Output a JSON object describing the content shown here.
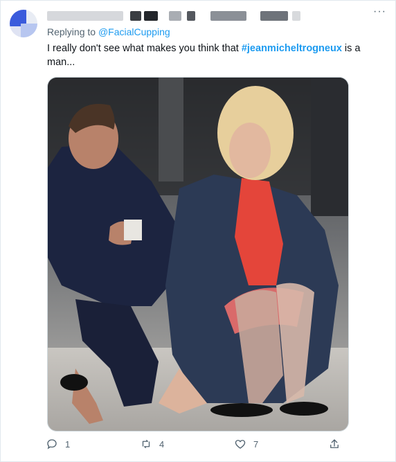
{
  "tweet": {
    "replying_prefix": "Replying to",
    "replying_handle": "@FacialCupping",
    "text_before": "I really don't see what makes you think that ",
    "hashtag": "#jeanmicheltrogneux",
    "text_after": " is a man...",
    "more_label": "···",
    "media_icon": "photo"
  },
  "actions": {
    "reply_count": "1",
    "retweet_count": "4",
    "like_count": "7",
    "reply_icon": "reply-icon",
    "retweet_icon": "retweet-icon",
    "like_icon": "heart-icon",
    "share_icon": "share-icon"
  },
  "colors": {
    "accent": "#1d9bf0",
    "secondary_text": "#536471",
    "primary_text": "#0f1419"
  }
}
